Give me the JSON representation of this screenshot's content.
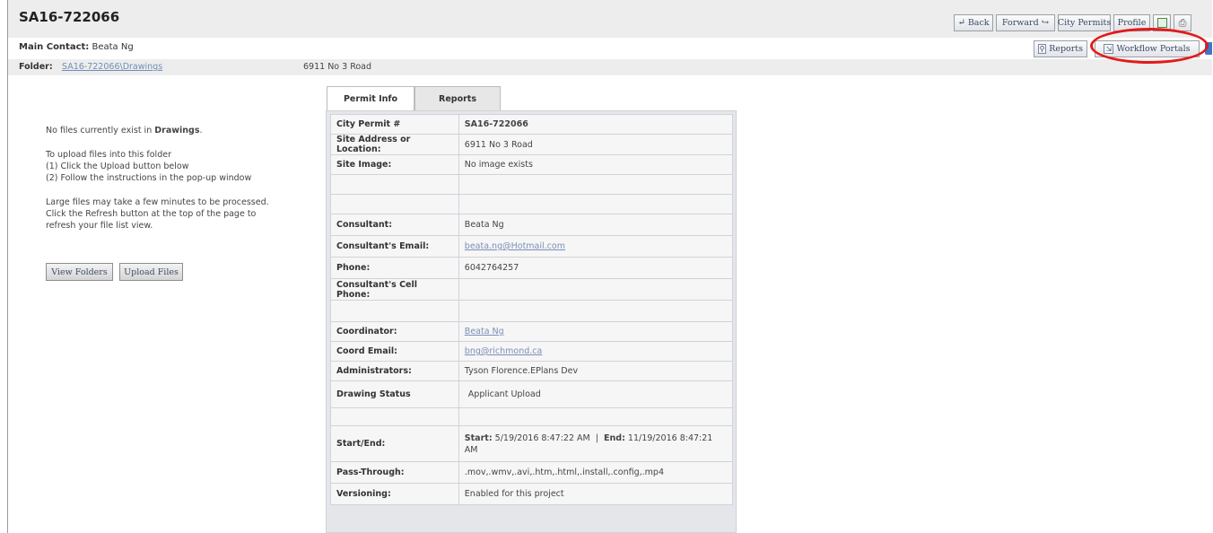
{
  "header": {
    "title": "SA16-722066",
    "main_contact_label": "Main Contact:",
    "main_contact_value": "Beata Ng"
  },
  "nav": {
    "back": "Back",
    "forward": "Forward",
    "city_permits": "City Permits",
    "profile": "Profile",
    "reports": "Reports",
    "workflow_portals": "Workflow Portals"
  },
  "folder": {
    "label": "Folder:",
    "path": "SA16-722066\\Drawings",
    "address": "6911 No 3 Road"
  },
  "left_panel": {
    "no_files_prefix": "No files currently exist in ",
    "no_files_folder": "Drawings",
    "no_files_suffix": ".",
    "upload_line1": "To upload files into this folder",
    "upload_line2": "(1) Click the Upload button below",
    "upload_line3": "(2) Follow the instructions in the pop-up window",
    "large_line1": "Large files may take a few minutes to be processed.",
    "large_line2": "Click the Refresh button at the top of the page to",
    "large_line3": "refresh your file list view.",
    "view_folders_button": "View Folders",
    "upload_files_button": "Upload Files"
  },
  "tabs": {
    "permit_info": "Permit Info",
    "reports": "Reports"
  },
  "permit": {
    "city_permit_label": "City Permit #",
    "city_permit_value": "SA16-722066",
    "site_address_label": "Site Address or Location:",
    "site_address_value": "6911 No 3 Road",
    "site_image_label": "Site Image:",
    "site_image_value": "No image exists",
    "consultant_label": "Consultant:",
    "consultant_value": "Beata Ng",
    "consultant_email_label": "Consultant's Email:",
    "consultant_email_value": "beata.ng@Hotmail.com",
    "phone_label": "Phone:",
    "phone_value": "6042764257",
    "cell_phone_label": "Consultant's Cell Phone:",
    "cell_phone_value": "",
    "coordinator_label": "Coordinator:",
    "coordinator_value": "Beata Ng",
    "coord_email_label": "Coord Email:",
    "coord_email_value": "bng@richmond.ca",
    "administrators_label": "Administrators:",
    "administrators_value": "Tyson Florence.EPlans Dev",
    "drawing_status_label": "Drawing Status",
    "drawing_status_value": "Applicant Upload",
    "start_end_label": "Start/End:",
    "start_prefix": "Start:",
    "start_value": "5/19/2016 8:47:22 AM",
    "separator": "|",
    "end_prefix": "End:",
    "end_value": "11/19/2016 8:47:21 AM",
    "pass_through_label": "Pass-Through:",
    "pass_through_value": ".mov,.wmv,.avi,.htm,.html,.install,.config,.mp4",
    "versioning_label": "Versioning:",
    "versioning_value": "Enabled for this project"
  },
  "colors": {
    "annotation_red": "#e11a1a",
    "link_blue": "#7a8fb8",
    "header_gray": "#ededed"
  }
}
